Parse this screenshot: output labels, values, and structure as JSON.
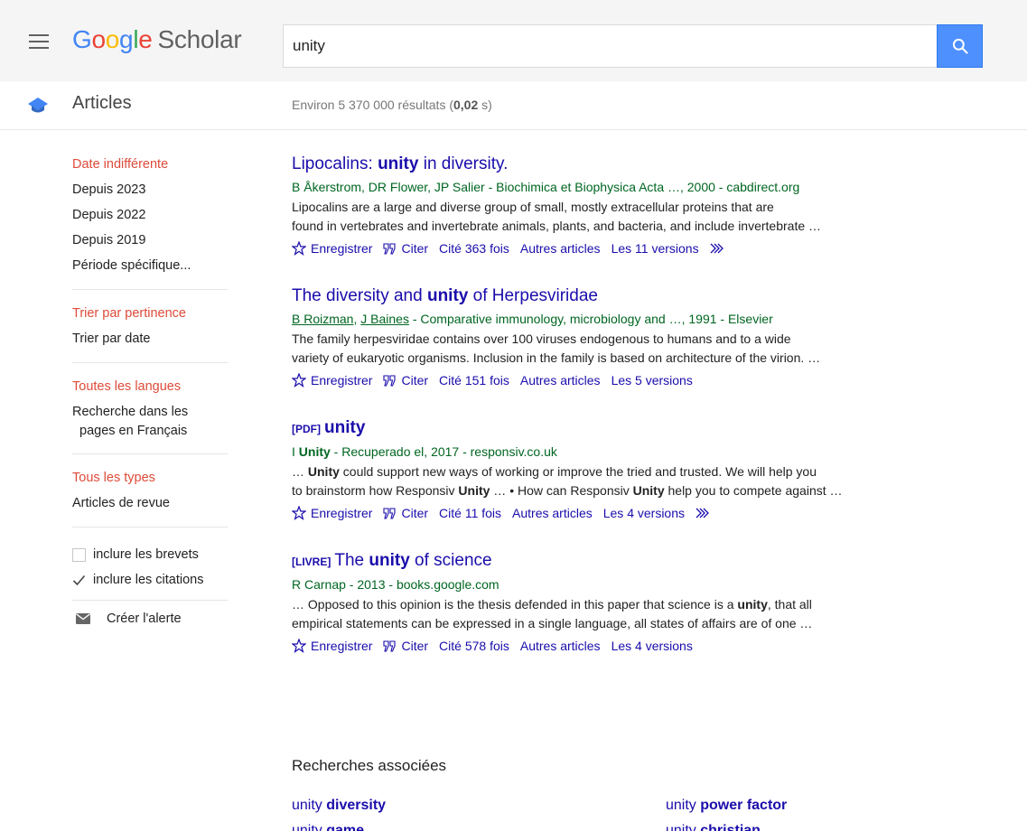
{
  "header": {
    "logo_google": [
      "G",
      "o",
      "o",
      "g",
      "l",
      "e"
    ],
    "logo_scholar": "Scholar",
    "search_value": "unity"
  },
  "subheader": {
    "section": "Articles",
    "count_prefix": "Environ 5 370 000 résultats (",
    "count_time": "0,02",
    "count_suffix": " s)"
  },
  "sidebar": {
    "date": [
      "Date indifférente",
      "Depuis 2023",
      "Depuis 2022",
      "Depuis 2019",
      "Période spécifique..."
    ],
    "sort": [
      "Trier par pertinence",
      "Trier par date"
    ],
    "lang": [
      "Toutes les langues",
      "Recherche dans les",
      "pages en Français"
    ],
    "type": [
      "Tous les types",
      "Articles de revue"
    ],
    "patents": "inclure les brevets",
    "citations": "inclure les citations",
    "alert": "Créer l'alerte"
  },
  "results": [
    {
      "title_pre": "Lipocalins: ",
      "title_bold": "unity",
      "title_post": " in diversity.",
      "authors": "B Åkerstrom, DR Flower, JP Salier - Biochimica et Biophysica Acta …, 2000 - cabdirect.org",
      "snippet1": "Lipocalins are a large and diverse group of small, mostly extracellular proteins that are",
      "snippet2": "found in vertebrates and invertebrate animals, plants, and bacteria, and include invertebrate …",
      "save": "Enregistrer",
      "cite": "Citer",
      "cited": "Cité 363 fois",
      "related": "Autres articles",
      "versions": "Les 11 versions"
    },
    {
      "title_pre": "The diversity and ",
      "title_bold": "unity",
      "title_post": " of Herpesviridae",
      "author1": "B Roizman",
      "author_sep": ", ",
      "author2": "J Baines",
      "authors_rest": " - Comparative immunology, microbiology and …, 1991 - Elsevier",
      "snippet1": "The family herpesviridae contains over 100 viruses endogenous to humans and to a wide",
      "snippet2": "variety of eukaryotic organisms. Inclusion in the family is based on architecture of the virion. …",
      "save": "Enregistrer",
      "cite": "Citer",
      "cited": "Cité 151 fois",
      "related": "Autres articles",
      "versions": "Les 5 versions"
    },
    {
      "tag": "[PDF]",
      "title_bold": "unity",
      "authors_pre": "I ",
      "authors_bold": "Unity",
      "authors_rest": " - Recuperado el, 2017 - responsiv.co.uk",
      "s1_a": "… ",
      "s1_b": "Unity",
      "s1_c": " could support new ways of working or improve the tried and trusted. We will help you",
      "s2_a": "to brainstorm how Responsiv ",
      "s2_b": "Unity",
      "s2_c": " … • How can Responsiv ",
      "s2_d": "Unity",
      "s2_e": " help you to compete against …",
      "save": "Enregistrer",
      "cite": "Citer",
      "cited": "Cité 11 fois",
      "related": "Autres articles",
      "versions": "Les 4 versions"
    },
    {
      "tag": "[LIVRE]",
      "title_pre": "The ",
      "title_bold": "unity",
      "title_post": " of science",
      "authors": "R Carnap - 2013 - books.google.com",
      "s1_a": "… Opposed to this opinion is the thesis defended in this paper that science is a ",
      "s1_b": "unity",
      "s1_c": ", that all",
      "snippet2": "empirical statements can be expressed in a single language, all states of affairs are of one …",
      "save": "Enregistrer",
      "cite": "Citer",
      "cited": "Cité 578 fois",
      "related": "Autres articles",
      "versions": "Les 4 versions"
    }
  ],
  "related": {
    "title": "Recherches associées",
    "items": [
      {
        "pre": "unity ",
        "bold": "diversity"
      },
      {
        "pre": "unity ",
        "bold": "power factor"
      },
      {
        "pre": "unity ",
        "bold": "game"
      },
      {
        "pre": "unity ",
        "bold": "christian"
      }
    ]
  },
  "colors": {
    "link": "#1a0dab",
    "green": "#006621",
    "active": "#dd4b39",
    "search_btn": "#4d90fe"
  }
}
